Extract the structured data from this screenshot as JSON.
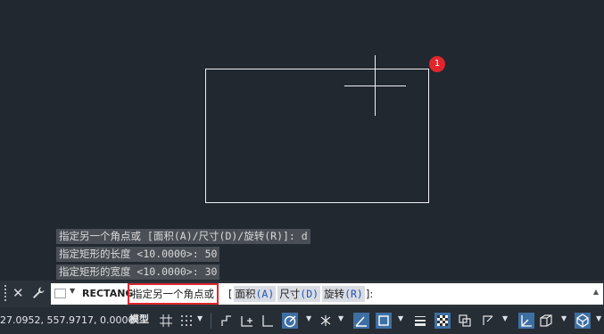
{
  "canvas": {
    "marker": "1"
  },
  "history": [
    "指定另一个角点或 [面积(A)/尺寸(D)/旋转(R)]: d",
    "指定矩形的长度 <10.0000>: 50",
    "指定矩形的宽度 <10.0000>: 30"
  ],
  "command_line": {
    "close": "✕",
    "command": "RECTANG",
    "prompt": "指定另一个角点或",
    "open_bracket": "[",
    "options": [
      {
        "label": "面积",
        "key": "(A)"
      },
      {
        "label": "尺寸",
        "key": "(D)"
      },
      {
        "label": "旋转",
        "key": "(R)"
      }
    ],
    "close_bracket": "]:"
  },
  "status_bar": {
    "coords": "27.0952, 557.9717, 0.0000",
    "model": "模型"
  },
  "colors": {
    "background": "#212830",
    "highlight": "#e0262c",
    "active_toggle": "#3e6fa3"
  },
  "icons": [
    "wrench-icon",
    "grid-icon",
    "snap-icon",
    "ortho-icon",
    "polar-icon",
    "osnap-icon",
    "lineweight-icon",
    "transparency-icon",
    "workspace-icon"
  ]
}
